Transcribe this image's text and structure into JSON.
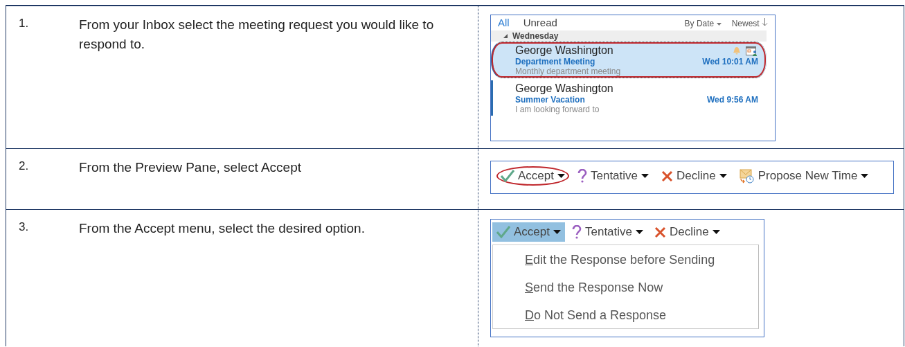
{
  "steps": [
    {
      "number": "1.",
      "instruction": "From your Inbox select the meeting request you would like to respond to.",
      "figure": {
        "kind": "inbox",
        "filters": [
          {
            "label": "All",
            "selected": true
          },
          {
            "label": "Unread",
            "selected": false
          }
        ],
        "sort": "By Date",
        "order": "Newest",
        "group": "Wednesday",
        "messages": [
          {
            "sender": "George Washington",
            "subject": "Department Meeting",
            "time": "Wed 10:01 AM",
            "preview": "Monthly department meeting",
            "selected": true,
            "circled": true,
            "reminder": true
          },
          {
            "sender": "George Washington",
            "subject": "Summer Vacation",
            "time": "Wed 9:56 AM",
            "preview": "I am looking forward to",
            "selected": false,
            "circled": false,
            "reminder": false
          }
        ]
      }
    },
    {
      "number": "2.",
      "instruction": "From the Preview Pane, select Accept",
      "figure": {
        "kind": "toolbar",
        "buttons": [
          {
            "kind": "accept",
            "label": "Accept",
            "selected": false,
            "circled": true
          },
          {
            "kind": "tentative",
            "label": "Tentative",
            "selected": false,
            "circled": false
          },
          {
            "kind": "decline",
            "label": "Decline",
            "selected": false,
            "circled": false
          },
          {
            "kind": "propose",
            "label": "Propose New Time",
            "selected": false,
            "circled": false
          }
        ]
      }
    },
    {
      "number": "3.",
      "instruction": "From the Accept menu, select the desired option.",
      "figure": {
        "kind": "menu",
        "buttons": [
          {
            "kind": "accept",
            "label": "Accept",
            "selected": true,
            "circled": false
          },
          {
            "kind": "tentative",
            "label": "Tentative",
            "selected": false,
            "circled": false
          },
          {
            "kind": "decline",
            "label": "Decline",
            "selected": false,
            "circled": false
          }
        ],
        "menu_items": [
          {
            "key": "E",
            "rest": "dit the Response before Sending"
          },
          {
            "key": "S",
            "rest": "end the Response Now"
          },
          {
            "key": "D",
            "rest": "o Not Send a Response"
          }
        ]
      }
    }
  ]
}
